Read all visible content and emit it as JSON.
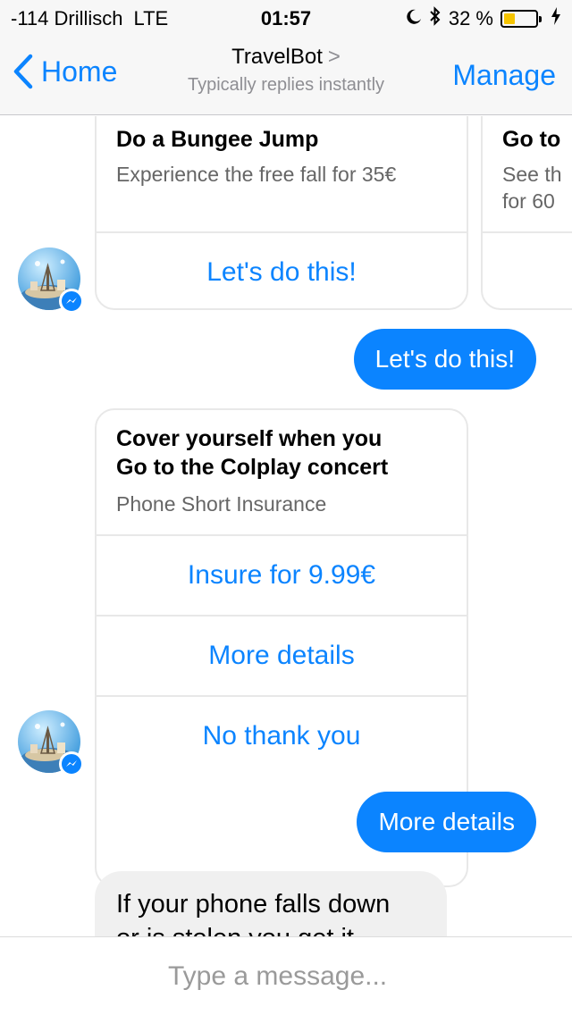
{
  "status_bar": {
    "carrier": "-114 Drillisch",
    "network": "LTE",
    "time": "01:57",
    "battery_text": "32 %",
    "battery_level": 0.32
  },
  "nav": {
    "back_label": "Home",
    "title": "TravelBot",
    "title_chevron": ">",
    "subtitle": "Typically replies instantly",
    "manage_label": "Manage"
  },
  "carousel": {
    "cards": [
      {
        "title": "Do a Bungee Jump",
        "subtitle": "Experience the free fall for 35€",
        "button": "Let's do this!"
      },
      {
        "title": "Go to",
        "subtitle_line1": "See th",
        "subtitle_line2": "for 60"
      }
    ]
  },
  "messages": {
    "user_reply_1": "Let's do this!",
    "insurance_card": {
      "title_line1": "Cover yourself when you",
      "title_line2": "Go to the Colplay concert",
      "subtitle": "Phone Short Insurance",
      "buttons": [
        "Insure for 9.99€",
        "More details",
        "No thank you"
      ]
    },
    "user_reply_2": "More details",
    "bot_text_line1": "If your phone falls down",
    "bot_text_line2": "or is stolen you get it"
  },
  "composer": {
    "placeholder": "Type a message..."
  },
  "colors": {
    "accent": "#0b84ff",
    "bubble_in": "#f0f0f0",
    "battery": "#f5c400"
  },
  "icons": {
    "back": "chevron-left-icon",
    "messenger_badge": "messenger-icon",
    "moon": "moon-icon",
    "bluetooth": "bluetooth-icon",
    "charging": "bolt-icon"
  }
}
